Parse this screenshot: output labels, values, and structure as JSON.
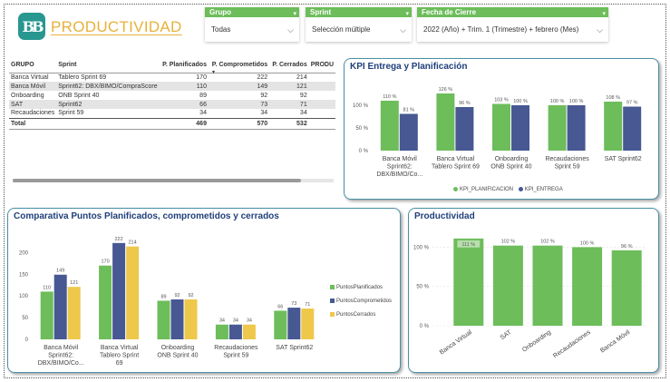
{
  "header": {
    "logo_text": "BB",
    "title": "PRODUCTIVIDAD"
  },
  "slicers": [
    {
      "label": "Grupo",
      "value": "Todas"
    },
    {
      "label": "Sprint",
      "value": "Selección múltiple"
    },
    {
      "label": "Fecha de Cierre",
      "value": "2022 (Año) + Trim. 1 (Trimestre) + febrero (Mes)"
    }
  ],
  "table": {
    "columns": [
      "GRUPO",
      "Sprint",
      "P. Planificados",
      "P. Comprometidos",
      "P. Cerrados",
      "PRODU"
    ],
    "rows": [
      [
        "Banca Virtual",
        "Tablero Sprint 69",
        "170",
        "222",
        "214"
      ],
      [
        "Banca Móvil",
        "Sprint62: DBX/BIMO/CompraScore",
        "110",
        "149",
        "121"
      ],
      [
        "Onboarding",
        "ONB Sprint 40",
        "89",
        "92",
        "92"
      ],
      [
        "SAT",
        "Sprint62",
        "66",
        "73",
        "71"
      ],
      [
        "Recaudaciones",
        "Sprint 59",
        "34",
        "34",
        "34"
      ]
    ],
    "total": [
      "Total",
      "",
      "469",
      "570",
      "532"
    ]
  },
  "kpi_panel": {
    "title": "KPI Entrega y Planificación",
    "legend": [
      "KPI_PLANIFICACION",
      "KPI_ENTREGA"
    ]
  },
  "comparativa_panel": {
    "title": "Comparativa Puntos Planificados, comprometidos y cerrados",
    "legend": [
      "PuntosPlanificados",
      "PuntosComprometidos",
      "PuntosCerrados"
    ]
  },
  "productividad_panel": {
    "title": "Productividad"
  },
  "colors": {
    "green": "#6dbd5b",
    "navy": "#475893",
    "yellow": "#eec84a",
    "panel_border": "#4a8fa6",
    "title_blue": "#1f3f7a",
    "gold": "#e8b13a",
    "teal": "#27978f"
  },
  "chart_data": [
    {
      "type": "bar",
      "title": "KPI Entrega y Planificación",
      "categories": [
        [
          "Banca Móvil",
          "Sprint62:",
          "DBX/BIMO/Co..."
        ],
        [
          "Banca Virtual",
          "Tablero Sprint 69"
        ],
        [
          "Onboarding",
          "ONB Sprint 40"
        ],
        [
          "Recaudaciones",
          "Sprint 59"
        ],
        [
          "SAT Sprint62"
        ]
      ],
      "series": [
        {
          "name": "KPI_PLANIFICACION",
          "values": [
            110,
            126,
            103,
            100,
            108
          ],
          "labels": [
            "110 %",
            "126 %",
            "103 %",
            "100 %",
            "108 %"
          ]
        },
        {
          "name": "KPI_ENTREGA",
          "values": [
            81,
            96,
            100,
            100,
            97
          ],
          "labels": [
            "81 %",
            "96 %",
            "100 %",
            "100 %",
            "97 %"
          ]
        }
      ],
      "yticks": [
        "0 %",
        "50 %",
        "100 %"
      ],
      "ylim": [
        0,
        130
      ],
      "legend": "bottom"
    },
    {
      "type": "bar",
      "title": "Comparativa Puntos Planificados, comprometidos y cerrados",
      "categories": [
        [
          "Banca Móvil",
          "Sprint62:",
          "DBX/BIMO/Co..."
        ],
        [
          "Banca Virtual",
          "Tablero Sprint",
          "69"
        ],
        [
          "Onboarding",
          "ONB Sprint 40"
        ],
        [
          "Recaudaciones",
          "Sprint 59"
        ],
        [
          "SAT Sprint62"
        ]
      ],
      "series": [
        {
          "name": "PuntosPlanificados",
          "values": [
            110,
            170,
            89,
            34,
            66
          ]
        },
        {
          "name": "PuntosComprometidos",
          "values": [
            149,
            222,
            92,
            34,
            73
          ]
        },
        {
          "name": "PuntosCerrados",
          "values": [
            121,
            214,
            92,
            34,
            71
          ]
        }
      ],
      "yticks": [
        "0",
        "50",
        "100",
        "150",
        "200"
      ],
      "ylim": [
        0,
        230
      ],
      "legend": "right"
    },
    {
      "type": "bar",
      "title": "Productividad",
      "categories": [
        "Banca Virtual",
        "SAT",
        "Onboarding",
        "Recaudaciones",
        "Banca Móvil"
      ],
      "series": [
        {
          "values": [
            111,
            102,
            102,
            100,
            96
          ],
          "labels": [
            "111 %",
            "102 %",
            "102 %",
            "100 %",
            "96 %"
          ]
        }
      ],
      "yticks": [
        "0 %",
        "50 %",
        "100 %"
      ],
      "ylim": [
        0,
        112
      ]
    }
  ]
}
